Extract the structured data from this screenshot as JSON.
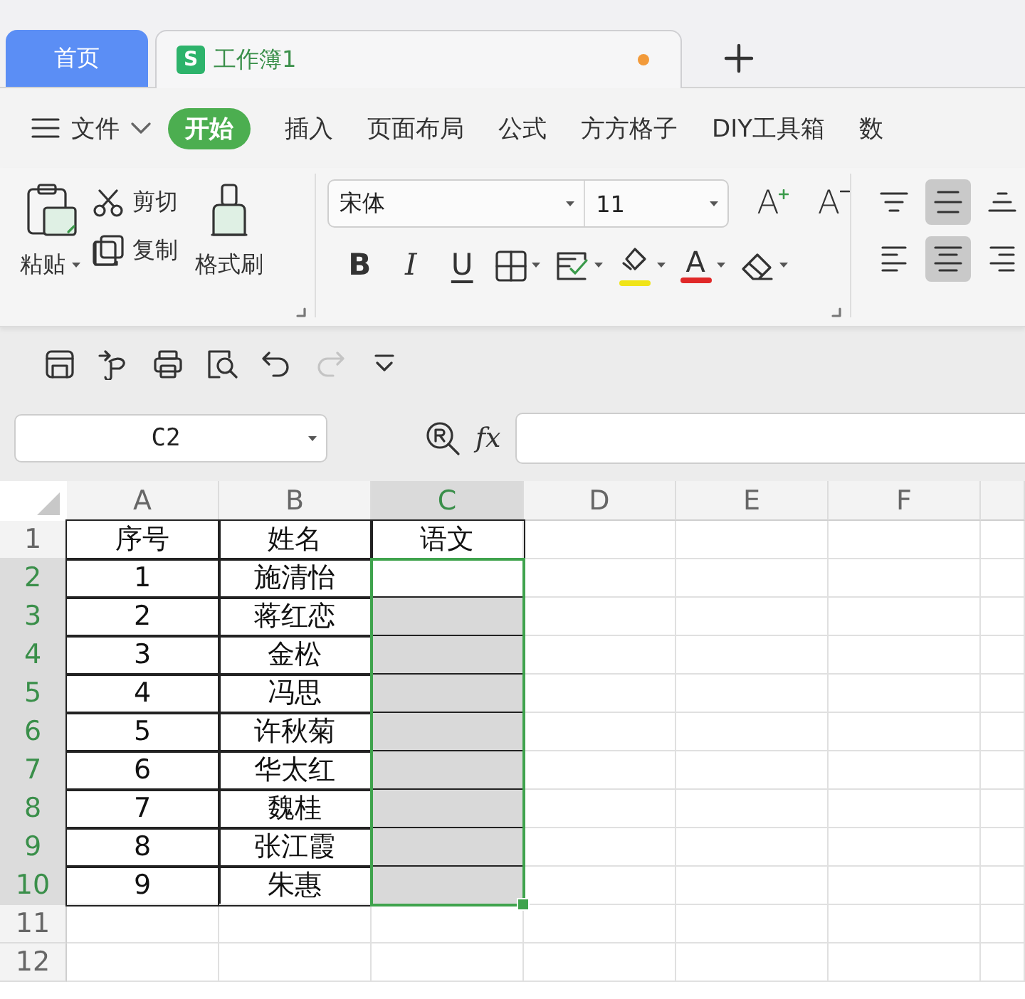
{
  "tabs": [
    {
      "kind": "home",
      "label": "首页",
      "selected": false
    },
    {
      "kind": "document",
      "badge": "S",
      "label": "工作簿1",
      "selected": true,
      "modified": true
    }
  ],
  "menu": {
    "file": "文件",
    "items": [
      {
        "label": "开始",
        "selected": true
      },
      {
        "label": "插入",
        "selected": false
      },
      {
        "label": "页面布局",
        "selected": false
      },
      {
        "label": "公式",
        "selected": false
      },
      {
        "label": "方方格子",
        "selected": false
      },
      {
        "label": "DIY工具箱",
        "selected": false
      },
      {
        "label": "数",
        "selected": false
      }
    ]
  },
  "ribbon": {
    "clipboard": {
      "paste": "粘贴",
      "cut": "剪切",
      "copy": "复制",
      "format_painter": "格式刷"
    },
    "font": {
      "name": "宋体",
      "size": "11",
      "grow": "A",
      "shrink": "A",
      "styles": [
        {
          "kind": "bold",
          "label": "B"
        },
        {
          "kind": "italic",
          "label": "I"
        },
        {
          "kind": "underline",
          "label": "U"
        }
      ],
      "font_color_label": "A"
    },
    "alignment": [
      {
        "kind": "top",
        "selected": false
      },
      {
        "kind": "middle",
        "selected": true
      },
      {
        "kind": "bottom",
        "selected": false
      },
      {
        "kind": "left",
        "selected": false
      },
      {
        "kind": "center",
        "selected": true
      },
      {
        "kind": "right",
        "selected": false
      }
    ]
  },
  "quick_access": [
    {
      "kind": "save",
      "disabled": false
    },
    {
      "kind": "export",
      "disabled": false
    },
    {
      "kind": "print",
      "disabled": false
    },
    {
      "kind": "preview",
      "disabled": false
    },
    {
      "kind": "undo",
      "disabled": false
    },
    {
      "kind": "redo",
      "disabled": true
    },
    {
      "kind": "more",
      "disabled": false
    }
  ],
  "formula_bar": {
    "name_box": "C2",
    "fx": "fx"
  },
  "sheet": {
    "columns": [
      {
        "label": "A",
        "selected": false
      },
      {
        "label": "B",
        "selected": false
      },
      {
        "label": "C",
        "selected": true
      },
      {
        "label": "D",
        "selected": false
      },
      {
        "label": "E",
        "selected": false
      },
      {
        "label": "F",
        "selected": false
      }
    ],
    "rows": [
      {
        "label": "1",
        "selected": false,
        "cells": [
          {
            "text": "序号",
            "bordered": true,
            "selected": false
          },
          {
            "text": "姓名",
            "bordered": true,
            "selected": false
          },
          {
            "text": "语文",
            "bordered": true,
            "selected": false
          }
        ]
      },
      {
        "label": "2",
        "selected": true,
        "cells": [
          {
            "text": "1",
            "bordered": true,
            "selected": false
          },
          {
            "text": "施清怡",
            "bordered": true,
            "selected": false
          },
          {
            "bordered": true,
            "selected": true,
            "active": true
          }
        ]
      },
      {
        "label": "3",
        "selected": true,
        "cells": [
          {
            "text": "2",
            "bordered": true,
            "selected": false
          },
          {
            "text": "蒋红恋",
            "bordered": true,
            "selected": false
          },
          {
            "bordered": true,
            "selected": true,
            "active": false
          }
        ]
      },
      {
        "label": "4",
        "selected": true,
        "cells": [
          {
            "text": "3",
            "bordered": true,
            "selected": false
          },
          {
            "text": "金松",
            "bordered": true,
            "selected": false
          },
          {
            "bordered": true,
            "selected": true,
            "active": false
          }
        ]
      },
      {
        "label": "5",
        "selected": true,
        "cells": [
          {
            "text": "4",
            "bordered": true,
            "selected": false
          },
          {
            "text": "冯思",
            "bordered": true,
            "selected": false
          },
          {
            "bordered": true,
            "selected": true,
            "active": false
          }
        ]
      },
      {
        "label": "6",
        "selected": true,
        "cells": [
          {
            "text": "5",
            "bordered": true,
            "selected": false
          },
          {
            "text": "许秋菊",
            "bordered": true,
            "selected": false
          },
          {
            "bordered": true,
            "selected": true,
            "active": false
          }
        ]
      },
      {
        "label": "7",
        "selected": true,
        "cells": [
          {
            "text": "6",
            "bordered": true,
            "selected": false
          },
          {
            "text": "华太红",
            "bordered": true,
            "selected": false
          },
          {
            "bordered": true,
            "selected": true,
            "active": false
          }
        ]
      },
      {
        "label": "8",
        "selected": true,
        "cells": [
          {
            "text": "7",
            "bordered": true,
            "selected": false
          },
          {
            "text": "魏桂",
            "bordered": true,
            "selected": false
          },
          {
            "bordered": true,
            "selected": true,
            "active": false
          }
        ]
      },
      {
        "label": "9",
        "selected": true,
        "cells": [
          {
            "text": "8",
            "bordered": true,
            "selected": false
          },
          {
            "text": "张江霞",
            "bordered": true,
            "selected": false
          },
          {
            "bordered": true,
            "selected": true,
            "active": false
          }
        ]
      },
      {
        "label": "10",
        "selected": true,
        "cells": [
          {
            "text": "9",
            "bordered": true,
            "selected": false
          },
          {
            "text": "朱惠",
            "bordered": true,
            "selected": false
          },
          {
            "bordered": true,
            "selected": true,
            "active": false
          }
        ]
      },
      {
        "label": "11",
        "selected": false,
        "cells": []
      },
      {
        "label": "12",
        "selected": false,
        "cells": []
      }
    ]
  }
}
